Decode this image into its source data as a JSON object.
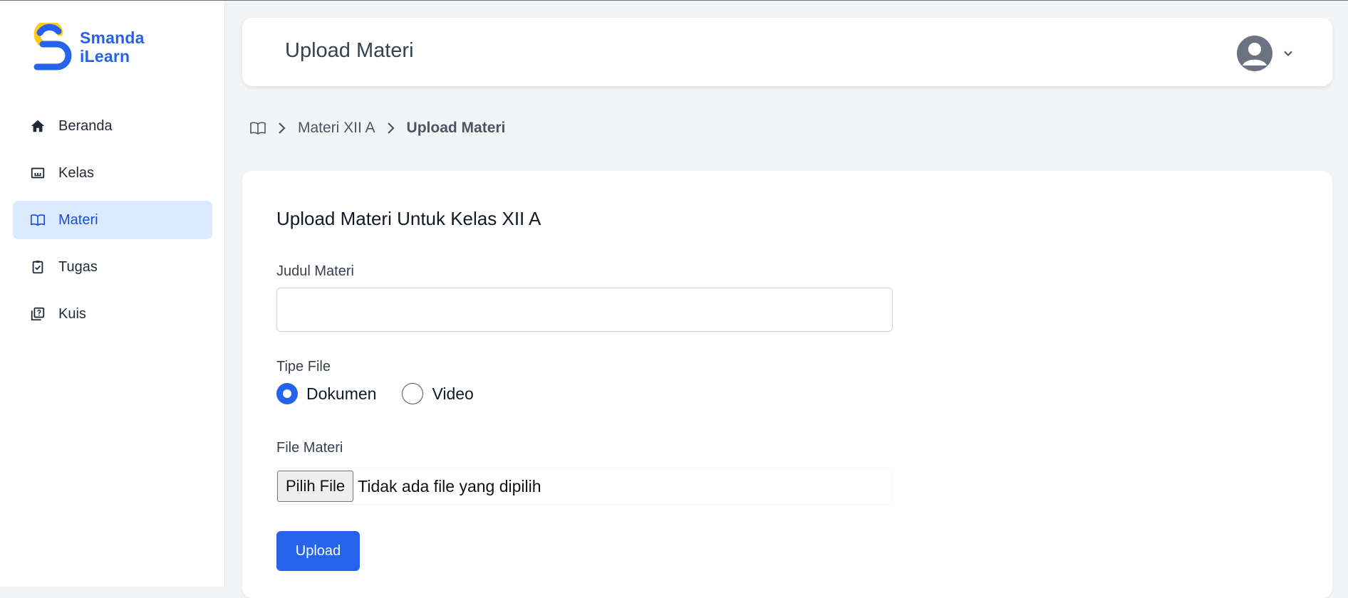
{
  "brand": {
    "line1": "Smanda",
    "line2": "iLearn",
    "accent": "#2563eb",
    "logo_secondary": "#facc15"
  },
  "sidebar": {
    "items": [
      {
        "label": "Beranda",
        "icon": "home-icon",
        "active": false
      },
      {
        "label": "Kelas",
        "icon": "class-board-icon",
        "active": false
      },
      {
        "label": "Materi",
        "icon": "book-icon",
        "active": true
      },
      {
        "label": "Tugas",
        "icon": "clipboard-check-icon",
        "active": false
      },
      {
        "label": "Kuis",
        "icon": "quiz-icon",
        "active": false
      }
    ]
  },
  "header": {
    "title": "Upload Materi",
    "user_icon": "user-avatar-icon",
    "dropdown_icon": "chevron-down-icon"
  },
  "breadcrumb": {
    "icon": "book-icon",
    "items": [
      "Materi XII A",
      "Upload Materi"
    ]
  },
  "form": {
    "title": "Upload Materi Untuk Kelas XII A",
    "judul": {
      "label": "Judul Materi",
      "value": "",
      "placeholder": ""
    },
    "tipe": {
      "label": "Tipe File",
      "options": [
        "Dokumen",
        "Video"
      ],
      "selected": "Dokumen"
    },
    "file": {
      "label": "File Materi",
      "button": "Pilih File",
      "status": "Tidak ada file yang dipilih"
    },
    "submit_label": "Upload"
  }
}
